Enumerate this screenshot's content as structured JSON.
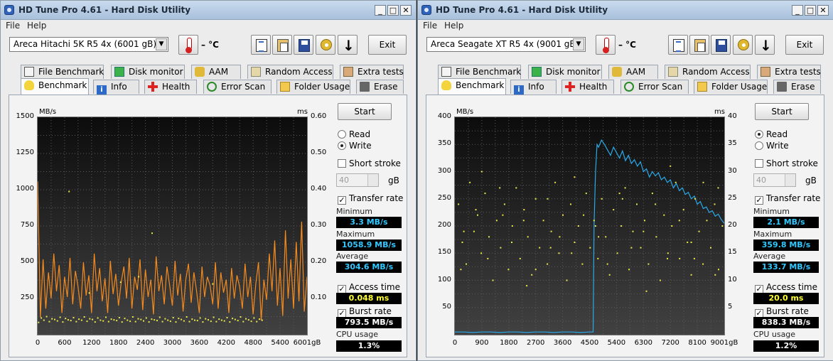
{
  "colors": {
    "accent_orange": "#f58b1f",
    "accent_blue": "#2aa8e8",
    "dots_yellow": "#e8e84a",
    "stat_cyan": "#31c8ff",
    "stat_yellow": "#ffff33",
    "stat_white": "#ffffff"
  },
  "windows": [
    {
      "title": "HD Tune Pro 4.61 - Hard Disk Utility",
      "menu": [
        "File",
        "Help"
      ],
      "drive": "Areca   Hitachi 5K R5 4x (6001 gB)",
      "temp": "– °C",
      "exit_label": "Exit",
      "tabs_top": [
        "File Benchmark",
        "Disk monitor",
        "AAM",
        "Random Access",
        "Extra tests"
      ],
      "tabs_bottom": [
        "Benchmark",
        "Info",
        "Health",
        "Error Scan",
        "Folder Usage",
        "Erase"
      ],
      "start_label": "Start",
      "read_label": "Read",
      "write_label": "Write",
      "mode": "write",
      "short_stroke_label": "Short stroke",
      "short_stroke_value": "40",
      "gb_unit": "gB",
      "transfer_rate_label": "Transfer rate",
      "minimum_label": "Minimum",
      "minimum_value": "3.3 MB/s",
      "maximum_label": "Maximum",
      "maximum_value": "1058.9 MB/s",
      "average_label": "Average",
      "average_value": "304.6 MB/s",
      "access_time_label": "Access time",
      "access_time_value": "0.048 ms",
      "burst_rate_label": "Burst rate",
      "burst_rate_value": "793.5 MB/s",
      "cpu_label": "CPU usage",
      "cpu_value": "1.3%"
    },
    {
      "title": "HD Tune Pro 4.61 - Hard Disk Utility",
      "menu": [
        "File",
        "Help"
      ],
      "drive": "Areca   Seagate XT R5 4x (9001 gB)",
      "temp": "– °C",
      "exit_label": "Exit",
      "tabs_top": [
        "File Benchmark",
        "Disk monitor",
        "AAM",
        "Random Access",
        "Extra tests"
      ],
      "tabs_bottom": [
        "Benchmark",
        "Info",
        "Health",
        "Error Scan",
        "Folder Usage",
        "Erase"
      ],
      "start_label": "Start",
      "read_label": "Read",
      "write_label": "Write",
      "mode": "read",
      "short_stroke_label": "Short stroke",
      "short_stroke_value": "40",
      "gb_unit": "gB",
      "transfer_rate_label": "Transfer rate",
      "minimum_label": "Minimum",
      "minimum_value": "2.1 MB/s",
      "maximum_label": "Maximum",
      "maximum_value": "359.8 MB/s",
      "average_label": "Average",
      "average_value": "133.7 MB/s",
      "access_time_label": "Access time",
      "access_time_value": "20.0 ms",
      "burst_rate_label": "Burst rate",
      "burst_rate_value": "838.3 MB/s",
      "cpu_label": "CPU usage",
      "cpu_value": "1.2%"
    }
  ],
  "chart_data": [
    {
      "type": "line",
      "ylabel": "MB/s",
      "y2label": "ms",
      "ylim": [
        0,
        1500
      ],
      "y2lim": [
        0,
        0.6
      ],
      "xlim": [
        0,
        6001
      ],
      "y_ticks": [
        "250",
        "500",
        "750",
        "1000",
        "1250",
        "1500"
      ],
      "y2_ticks": [
        "0.10",
        "0.20",
        "0.30",
        "0.40",
        "0.50",
        "0.60"
      ],
      "x_ticks": [
        "0",
        "600",
        "1200",
        "1800",
        "2400",
        "3000",
        "3600",
        "4200",
        "4800",
        "5400",
        "6001gB"
      ],
      "x_unit": "gB",
      "series": [
        {
          "kind": "transfer",
          "color": "#f58b1f",
          "x": [
            0,
            60,
            120,
            180,
            240,
            300,
            360,
            420,
            480,
            540,
            600,
            660,
            720,
            780,
            840,
            900,
            960,
            1020,
            1080,
            1140,
            1200,
            1260,
            1320,
            1380,
            1440,
            1500,
            1560,
            1620,
            1680,
            1740,
            1800,
            1860,
            1920,
            1980,
            2040,
            2100,
            2160,
            2220,
            2280,
            2340,
            2400,
            2460,
            2520,
            2580,
            2640,
            2700,
            2760,
            2820,
            2880,
            2940,
            3000,
            3060,
            3120,
            3180,
            3240,
            3300,
            3360,
            3420,
            3480,
            3540,
            3600,
            3660,
            3720,
            3780,
            3840,
            3900,
            3960,
            4020,
            4080,
            4140,
            4200,
            4260,
            4320,
            4380,
            4440,
            4500,
            4560,
            4620,
            4680,
            4740,
            4800,
            4860,
            4920,
            4980,
            5040,
            5100,
            5160,
            5220,
            5280,
            5340,
            5400,
            5460,
            5520,
            5580,
            5640,
            5700,
            5760,
            5820,
            5880,
            5940,
            6001
          ],
          "y": [
            1058,
            120,
            520,
            180,
            430,
            250,
            560,
            300,
            480,
            150,
            400,
            260,
            530,
            210,
            440,
            330,
            180,
            500,
            270,
            410,
            150,
            560,
            300,
            460,
            230,
            390,
            150,
            510,
            280,
            420,
            200,
            360,
            470,
            250,
            530,
            180,
            400,
            310,
            520,
            170,
            450,
            260,
            380,
            140,
            540,
            300,
            410,
            210,
            470,
            340,
            200,
            510,
            270,
            420,
            160,
            380,
            490,
            220,
            430,
            300,
            150,
            470,
            260,
            400,
            340,
            210,
            500,
            180,
            430,
            290,
            380,
            150,
            460,
            250,
            410,
            330,
            180,
            490,
            260,
            400,
            140,
            350,
            500,
            100,
            380,
            240,
            560,
            300,
            650,
            200,
            460,
            130,
            720,
            250,
            520,
            180,
            640,
            230,
            780,
            160,
            400
          ]
        },
        {
          "kind": "access",
          "color": "#e8e84a",
          "x": [
            20,
            80,
            140,
            200,
            260,
            320,
            380,
            440,
            500,
            560,
            620,
            680,
            740,
            800,
            860,
            920,
            980,
            1040,
            1100,
            1160,
            1220,
            1280,
            1340,
            1400,
            1460,
            1520,
            1580,
            1640,
            1700,
            1760,
            1820,
            1880,
            1940,
            2000,
            2060,
            2120,
            2180,
            2240,
            2300,
            2360,
            2420,
            2480,
            2540,
            2600,
            2660,
            2720,
            2780,
            2840,
            2900,
            2960,
            3020,
            3080,
            3140,
            3200,
            3260,
            3320,
            3380,
            3440,
            3500,
            3560,
            3620,
            3680,
            3740,
            3800,
            3860,
            3920,
            3980,
            4040,
            4100,
            4160,
            4220,
            4280,
            4340,
            4400,
            4460,
            4520,
            4580,
            4640,
            4700,
            4760,
            4820,
            4880,
            4940,
            5000,
            700,
            1850,
            2250,
            2550,
            1150,
            3900
          ],
          "y": [
            0.034,
            0.046,
            0.04,
            0.05,
            0.036,
            0.044,
            0.042,
            0.038,
            0.048,
            0.035,
            0.045,
            0.041,
            0.039,
            0.047,
            0.036,
            0.043,
            0.04,
            0.049,
            0.037,
            0.044,
            0.042,
            0.035,
            0.046,
            0.04,
            0.038,
            0.048,
            0.036,
            0.043,
            0.041,
            0.039,
            0.047,
            0.035,
            0.045,
            0.04,
            0.037,
            0.049,
            0.036,
            0.044,
            0.042,
            0.038,
            0.046,
            0.035,
            0.043,
            0.041,
            0.039,
            0.048,
            0.036,
            0.044,
            0.04,
            0.037,
            0.047,
            0.035,
            0.045,
            0.042,
            0.038,
            0.049,
            0.036,
            0.043,
            0.04,
            0.039,
            0.046,
            0.035,
            0.044,
            0.041,
            0.037,
            0.048,
            0.036,
            0.043,
            0.04,
            0.038,
            0.047,
            0.035,
            0.045,
            0.042,
            0.039,
            0.049,
            0.036,
            0.044,
            0.041,
            0.037,
            0.046,
            0.036,
            0.043,
            0.04,
            0.395,
            0.145,
            0.16,
            0.28,
            0.115,
            0.14
          ]
        }
      ]
    },
    {
      "type": "line",
      "ylabel": "MB/s",
      "y2label": "ms",
      "ylim": [
        0,
        400
      ],
      "y2lim": [
        0,
        40
      ],
      "xlim": [
        0,
        9001
      ],
      "y_ticks": [
        "50",
        "100",
        "150",
        "200",
        "250",
        "300",
        "350",
        "400"
      ],
      "y2_ticks": [
        "5",
        "10",
        "15",
        "20",
        "25",
        "30",
        "35",
        "40"
      ],
      "x_ticks": [
        "0",
        "900",
        "1800",
        "2700",
        "3600",
        "4500",
        "5400",
        "6300",
        "7200",
        "8100",
        "9001gB"
      ],
      "x_unit": "gB",
      "series": [
        {
          "kind": "transfer",
          "color": "#2aa8e8",
          "x": [
            0,
            300,
            600,
            900,
            1200,
            1500,
            1800,
            2100,
            2400,
            2700,
            3000,
            3300,
            3600,
            3900,
            4200,
            4500,
            4620,
            4650,
            4700,
            4750,
            4800,
            4900,
            5000,
            5100,
            5200,
            5300,
            5400,
            5500,
            5600,
            5700,
            5800,
            5900,
            6000,
            6100,
            6200,
            6300,
            6400,
            6500,
            6600,
            6700,
            6800,
            6900,
            7000,
            7100,
            7200,
            7300,
            7400,
            7500,
            7600,
            7700,
            7800,
            7900,
            8000,
            8100,
            8200,
            8300,
            8400,
            8500,
            8600,
            8700,
            8800,
            8900,
            9001
          ],
          "y": [
            5,
            5,
            4,
            5,
            5,
            4,
            5,
            5,
            4,
            5,
            5,
            4,
            5,
            5,
            4,
            5,
            5,
            200,
            300,
            350,
            345,
            358,
            350,
            340,
            330,
            345,
            335,
            325,
            338,
            320,
            330,
            315,
            322,
            310,
            318,
            300,
            305,
            290,
            300,
            292,
            298,
            285,
            290,
            280,
            285,
            270,
            278,
            265,
            270,
            258,
            262,
            250,
            255,
            240,
            245,
            232,
            235,
            225,
            228,
            218,
            222,
            212,
            205
          ]
        },
        {
          "kind": "access",
          "color": "#e8e84a",
          "x": [
            120,
            250,
            380,
            500,
            640,
            760,
            880,
            1010,
            1140,
            1270,
            1400,
            1530,
            1660,
            1790,
            1920,
            2050,
            2180,
            2310,
            2440,
            2570,
            2700,
            2830,
            2960,
            3090,
            3220,
            3350,
            3480,
            3610,
            3740,
            3870,
            4000,
            4130,
            4260,
            4390,
            4520,
            4650,
            4780,
            4910,
            5040,
            5170,
            5300,
            5430,
            5560,
            5690,
            5820,
            5950,
            6080,
            6210,
            6340,
            6470,
            6600,
            6730,
            6860,
            6990,
            7120,
            7250,
            7380,
            7510,
            7640,
            7770,
            7900,
            8030,
            8160,
            8290,
            8420,
            8550,
            8680,
            8810,
            8940,
            300,
            700,
            1100,
            1500,
            1900,
            2300,
            2700,
            3100,
            3500,
            3900,
            4300,
            4700,
            5100,
            5500,
            5900,
            6300,
            6700,
            7100,
            7500,
            7900,
            8300,
            8700,
            200,
            900,
            1600,
            2400,
            3200,
            4000,
            4800,
            5600,
            6400,
            7200,
            8000,
            8800
          ],
          "y": [
            24,
            17,
            13,
            28,
            19,
            22,
            15,
            26,
            18,
            10,
            21,
            16,
            24,
            12,
            20,
            27,
            14,
            23,
            18,
            11,
            25,
            16,
            21,
            13,
            19,
            28,
            15,
            22,
            10,
            24,
            17,
            20,
            13,
            26,
            16,
            21,
            14,
            25,
            18,
            11,
            23,
            15,
            20,
            27,
            12,
            19,
            24,
            16,
            21,
            13,
            26,
            18,
            10,
            22,
            15,
            20,
            28,
            14,
            23,
            17,
            11,
            25,
            19,
            13,
            21,
            16,
            24,
            12,
            20,
            19,
            23,
            14,
            27,
            17,
            21,
            12,
            25,
            18,
            15,
            22,
            20,
            13,
            26,
            16,
            19,
            24,
            14,
            21,
            17,
            28,
            11,
            12,
            30,
            22,
            9,
            16,
            29,
            18,
            25,
            8,
            31,
            14,
            27
          ]
        }
      ]
    }
  ]
}
